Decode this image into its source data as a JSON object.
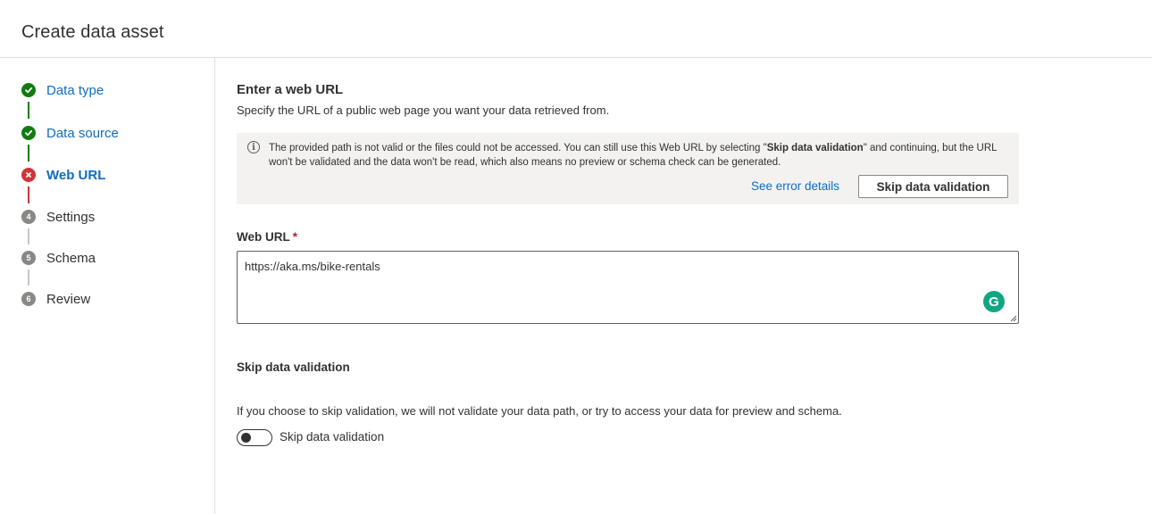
{
  "header": {
    "title": "Create data asset"
  },
  "steps": [
    {
      "number": "1",
      "label": "Data type",
      "status": "complete"
    },
    {
      "number": "2",
      "label": "Data source",
      "status": "complete"
    },
    {
      "number": "3",
      "label": "Web URL",
      "status": "error"
    },
    {
      "number": "4",
      "label": "Settings",
      "status": "pending"
    },
    {
      "number": "5",
      "label": "Schema",
      "status": "pending"
    },
    {
      "number": "6",
      "label": "Review",
      "status": "pending"
    }
  ],
  "main": {
    "title": "Enter a web URL",
    "description": "Specify the URL of a public web page you want your data retrieved from.",
    "banner": {
      "icon": "info-icon",
      "text_before": "The provided path is not valid or the files could not be accessed. You can still use this Web URL by selecting \"",
      "text_bold": "Skip data validation",
      "text_after": "\" and continuing, but the URL won't be validated and the data won't be read, which also means no preview or schema check can be generated.",
      "link_label": "See error details",
      "button_label": "Skip data validation"
    },
    "web_url": {
      "label": "Web URL",
      "required_mark": "*",
      "value": "https://aka.ms/bike-rentals",
      "grammarly_letter": "G"
    },
    "skip": {
      "heading": "Skip data validation",
      "description": "If you choose to skip validation, we will not validate your data path, or try to access your data for preview and schema.",
      "toggle_label": "Skip data validation",
      "toggle_on": false
    }
  },
  "colors": {
    "accent": "#0f6cbd",
    "success": "#107c10",
    "error": "#d13438",
    "banner_bg": "#f3f2f1",
    "border": "#e1dfdd"
  }
}
